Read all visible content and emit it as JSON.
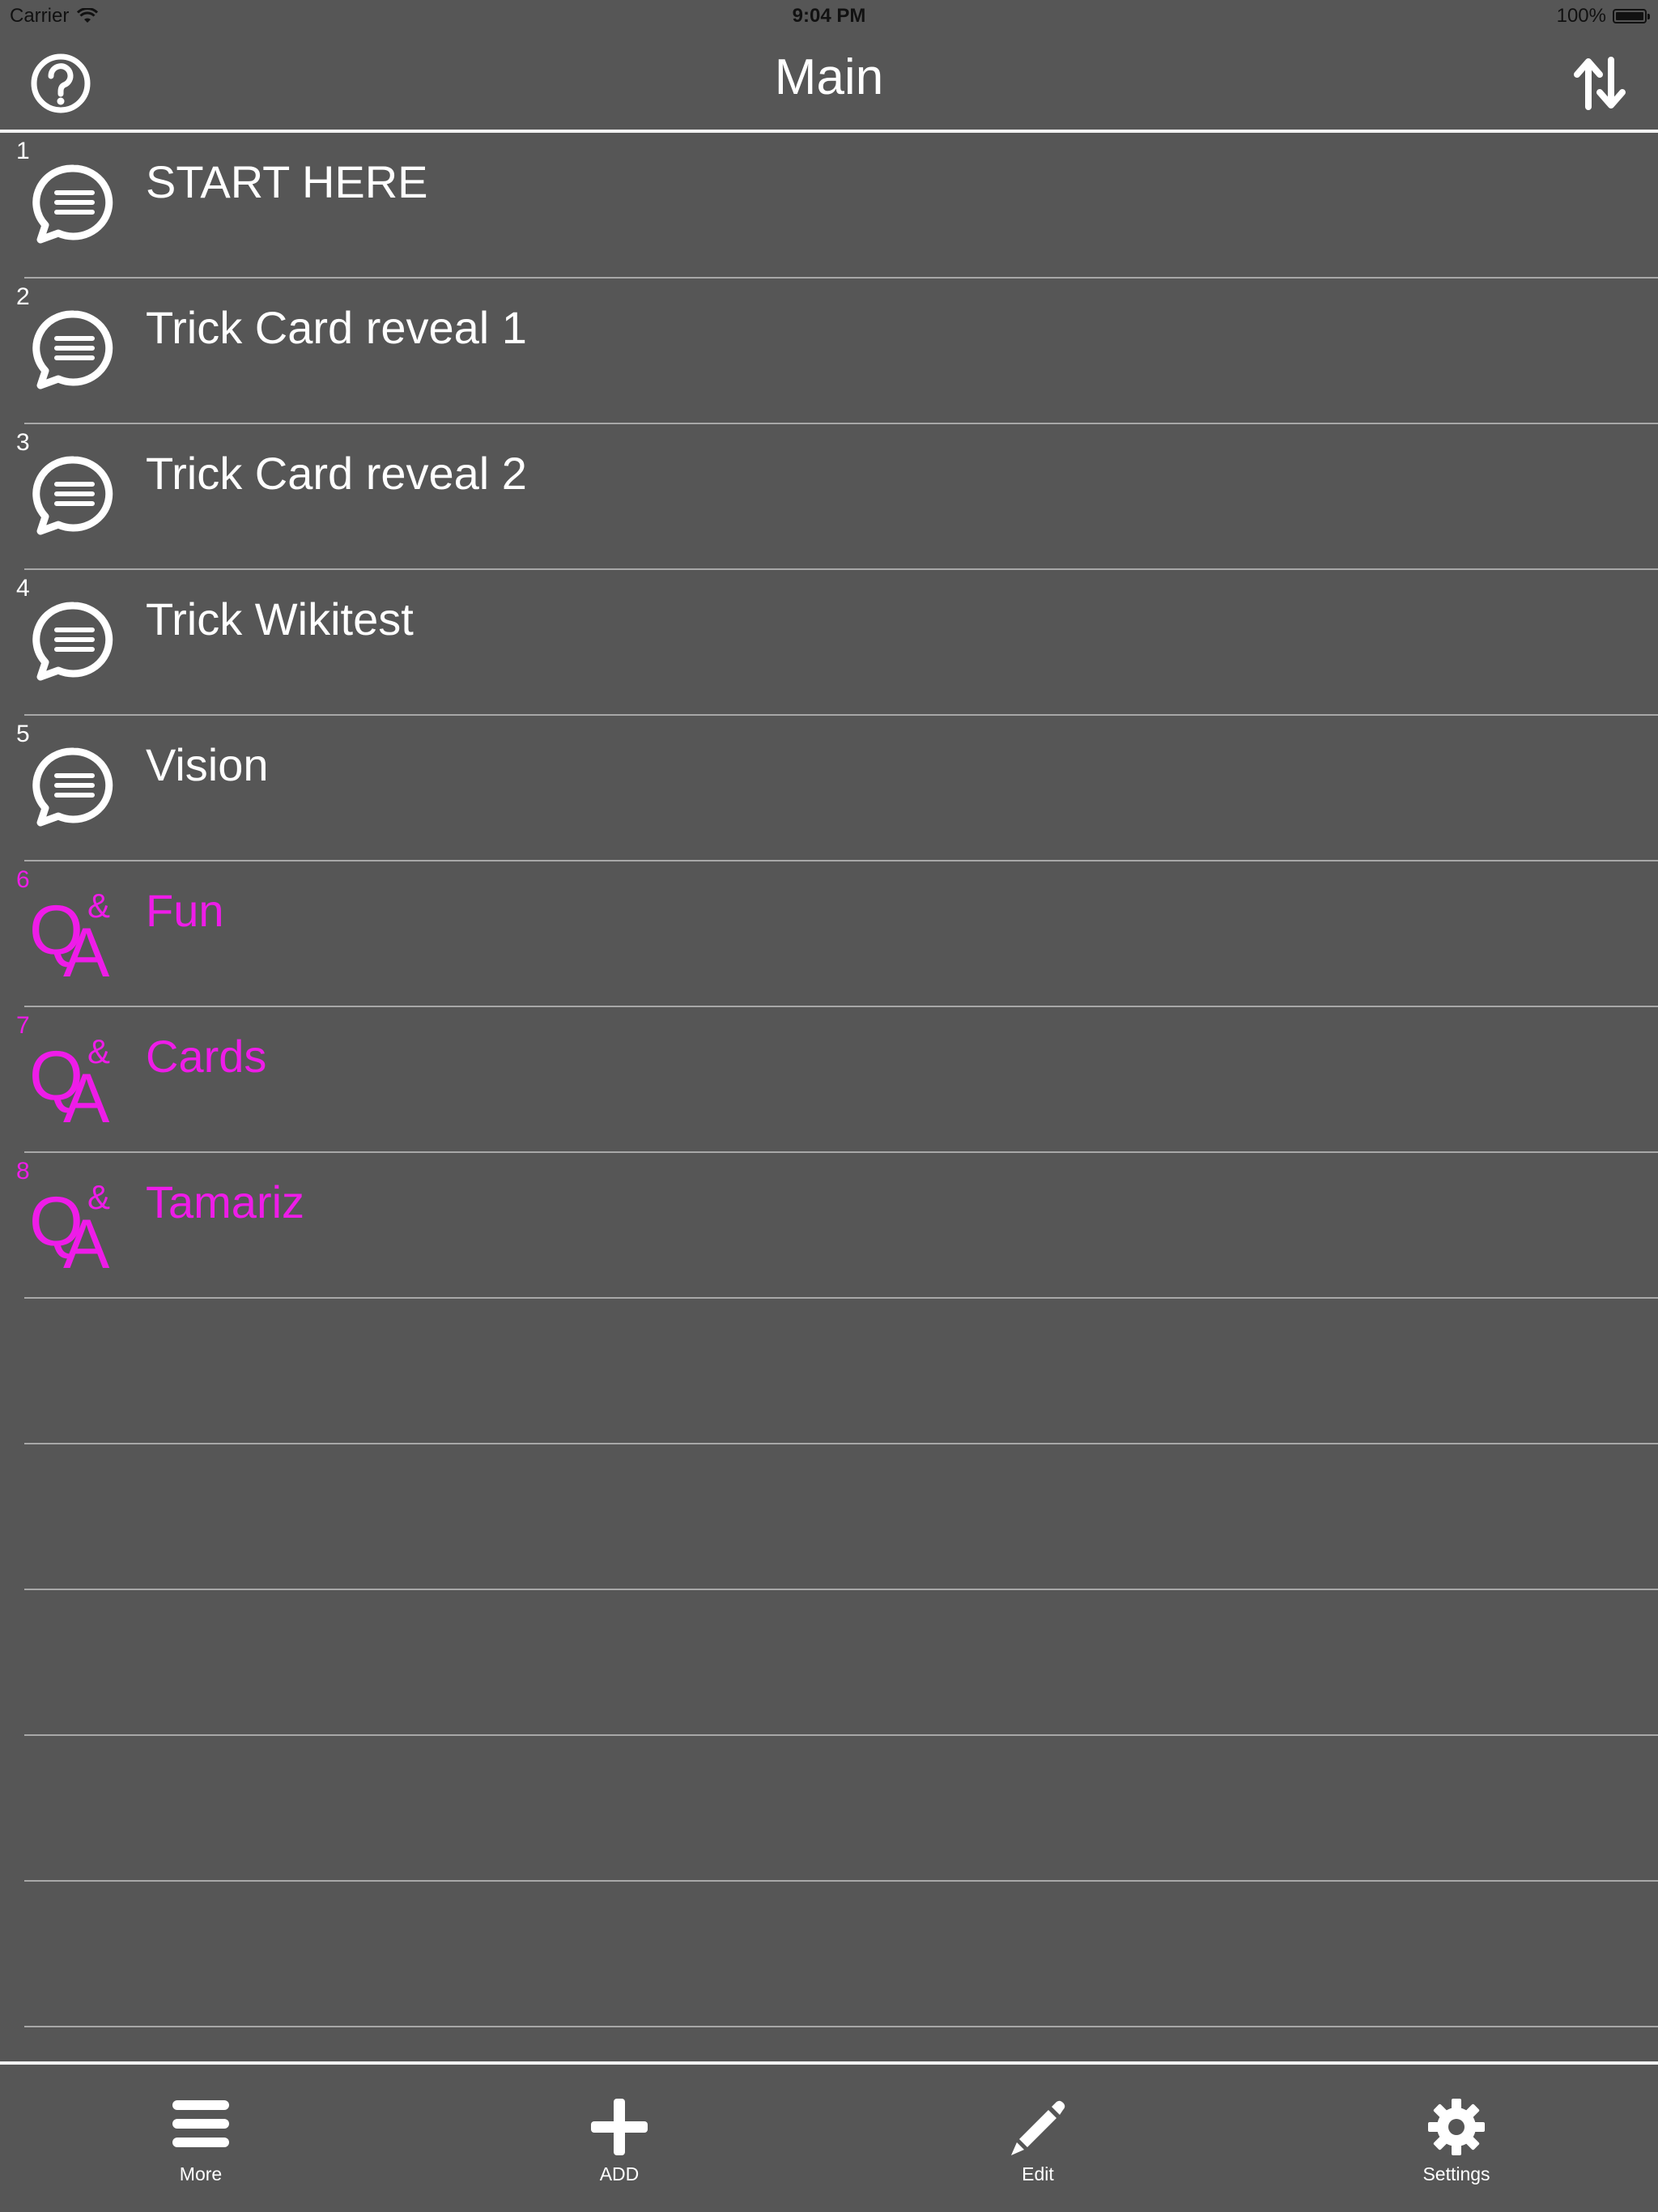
{
  "status_bar": {
    "carrier": "Carrier",
    "time": "9:04 PM",
    "battery": "100%"
  },
  "nav": {
    "title": "Main",
    "left_icon": "help-circle-icon",
    "right_icon": "sort-arrows-icon"
  },
  "items": [
    {
      "num": "1",
      "title": "START HERE",
      "type": "note"
    },
    {
      "num": "2",
      "title": "Trick Card reveal 1",
      "type": "note"
    },
    {
      "num": "3",
      "title": "Trick Card reveal 2",
      "type": "note"
    },
    {
      "num": "4",
      "title": "Trick Wikitest",
      "type": "note"
    },
    {
      "num": "5",
      "title": "Vision",
      "type": "note"
    },
    {
      "num": "6",
      "title": "Fun",
      "type": "qa"
    },
    {
      "num": "7",
      "title": "Cards",
      "type": "qa"
    },
    {
      "num": "8",
      "title": "Tamariz",
      "type": "qa"
    }
  ],
  "qa_icon": {
    "q": "Q",
    "a": "A",
    "amp": "&"
  },
  "tabs": [
    {
      "label": "More",
      "icon": "menu-icon"
    },
    {
      "label": "ADD",
      "icon": "plus-icon"
    },
    {
      "label": "Edit",
      "icon": "pencil-icon"
    },
    {
      "label": "Settings",
      "icon": "gear-icon"
    }
  ],
  "colors": {
    "background": "#565656",
    "qa_accent": "#ee1ce8",
    "text": "#ffffff"
  }
}
